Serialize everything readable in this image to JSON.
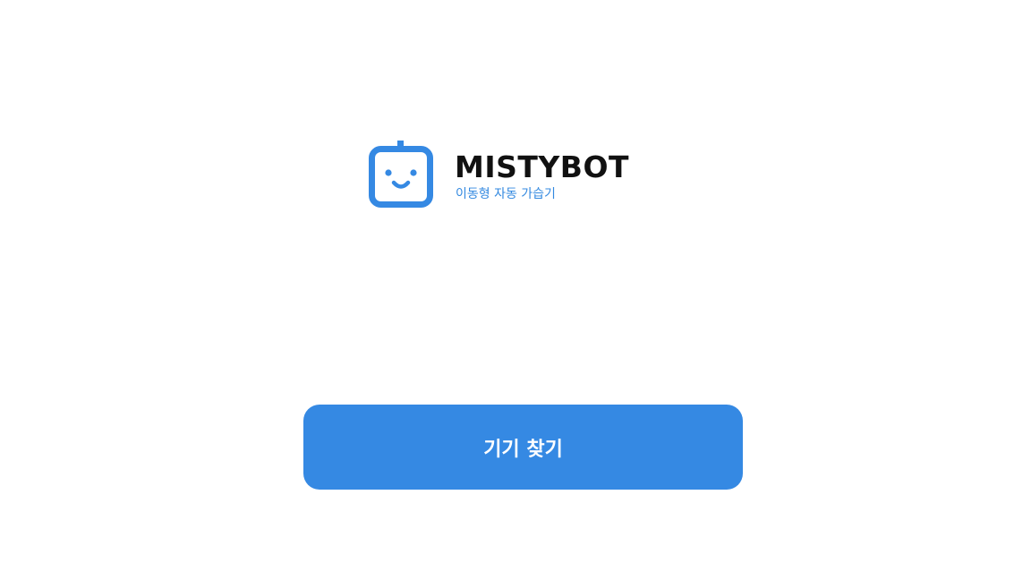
{
  "logo": {
    "brand_name": "MISTYBOT",
    "tagline": "이동형 자동 가습기",
    "icon": "robot-face-icon"
  },
  "actions": {
    "find_device_label": "기기 찾기"
  },
  "colors": {
    "accent": "#3589e3",
    "brand_text": "#111111",
    "background": "#ffffff"
  }
}
